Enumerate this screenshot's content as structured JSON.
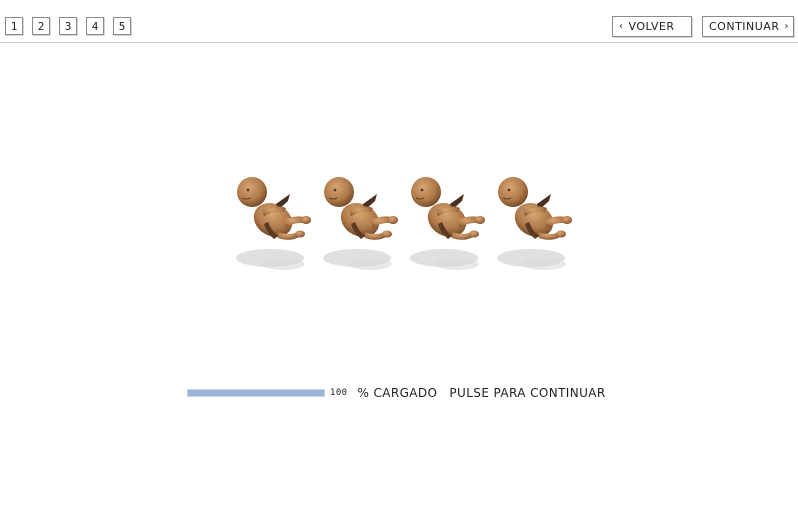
{
  "nav": {
    "pages": [
      "1",
      "2",
      "3",
      "4",
      "5"
    ],
    "back_label": "VOLVER",
    "next_label": "CONTINUAR",
    "back_icon": "chevron-left-icon",
    "next_icon": "chevron-right-icon"
  },
  "babies": {
    "count": 4,
    "skin_color": "#b07a4a",
    "shadow_color": "#d8d8d8"
  },
  "loader": {
    "progress": 1.0,
    "value": "100",
    "percent_label": "% CARGADO",
    "continue_label": "PULSE PARA CONTINUAR",
    "bar_color": "#9bb3d8"
  }
}
